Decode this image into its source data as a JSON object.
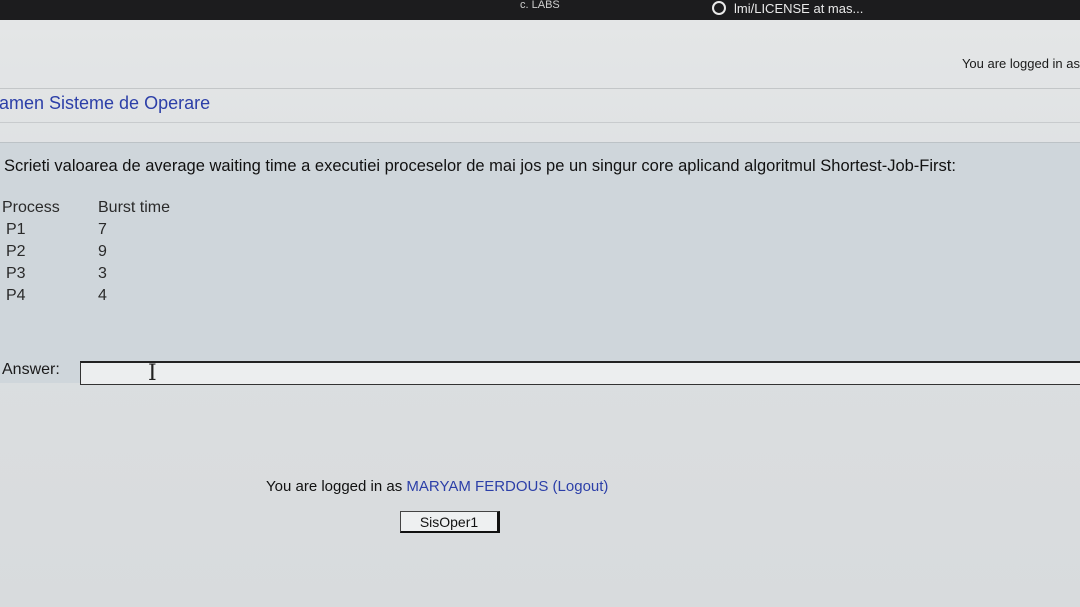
{
  "browser": {
    "tab_text": "c. LABS",
    "tab_text2": "lmi/LICENSE at mas..."
  },
  "header": {
    "login_status": "You are logged in as"
  },
  "course": {
    "title": "xamen Sisteme de Operare"
  },
  "question": {
    "text": "Scrieti valoarea de average waiting time a executiei proceselor de mai jos pe un singur core aplicand algoritmul Shortest-Job-First:",
    "table": {
      "headers": [
        "Process",
        "Burst time"
      ],
      "rows": [
        [
          "P1",
          "7"
        ],
        [
          "P2",
          "9"
        ],
        [
          "P3",
          "3"
        ],
        [
          "P4",
          "4"
        ]
      ]
    },
    "answer_label": "Answer:",
    "answer_value": ""
  },
  "footer": {
    "logged_in_prefix": "You are logged in as",
    "user_name": "MARYAM FERDOUS",
    "logout_label": "(Logout)",
    "home_button_label": "SisOper1"
  }
}
